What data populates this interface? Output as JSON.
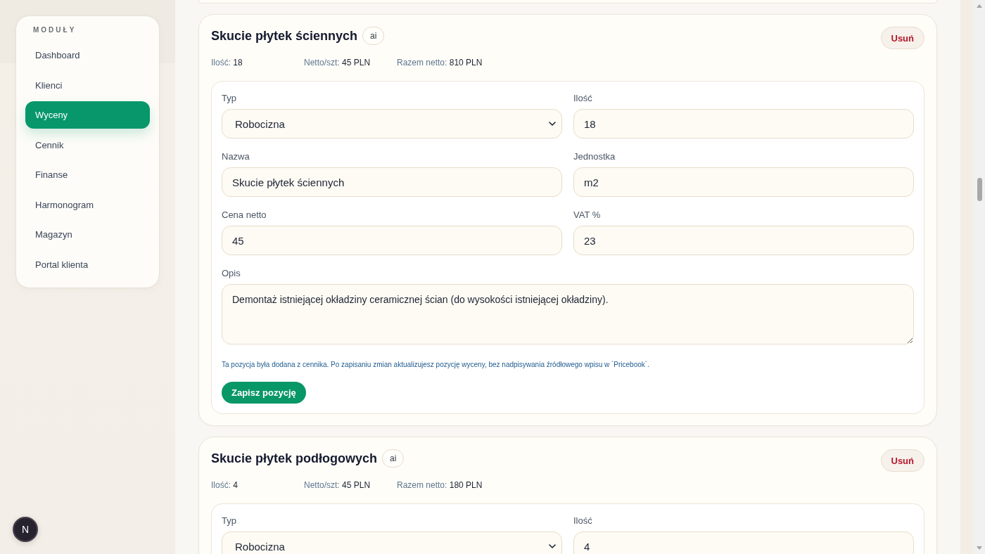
{
  "sidebar": {
    "heading": "MODUŁY",
    "items": [
      {
        "label": "Dashboard",
        "selected": false
      },
      {
        "label": "Klienci",
        "selected": false
      },
      {
        "label": "Wyceny",
        "selected": true
      },
      {
        "label": "Cennik",
        "selected": false
      },
      {
        "label": "Finanse",
        "selected": false
      },
      {
        "label": "Harmonogram",
        "selected": false
      },
      {
        "label": "Magazyn",
        "selected": false
      },
      {
        "label": "Portal klienta",
        "selected": false
      }
    ]
  },
  "dev_badge": {
    "label": "N"
  },
  "positions": [
    {
      "title": "Skucie płytek ściennych",
      "tag": "ai",
      "delete_button": "Usuń",
      "summary": [
        {
          "label": "Ilość:",
          "value": "18"
        },
        {
          "label": "Netto/szt:",
          "value": "45 PLN"
        },
        {
          "label": "Razem netto:",
          "value": "810 PLN"
        }
      ],
      "form": {
        "fields": [
          {
            "kind": "select",
            "label": "Typ",
            "value": "Robocizna"
          },
          {
            "kind": "input",
            "label": "Ilość",
            "value": "18"
          },
          {
            "kind": "input",
            "label": "Nazwa",
            "value": "Skucie płytek ściennych"
          },
          {
            "kind": "input",
            "label": "Jednostka",
            "value": "m2"
          },
          {
            "kind": "input",
            "label": "Cena netto",
            "value": "45"
          },
          {
            "kind": "input",
            "label": "VAT %",
            "value": "23"
          },
          {
            "kind": "textarea",
            "label": "Opis",
            "value": "Demontaż istniejącej okładziny ceramicznej ścian (do wysokości istniejącej okładziny)."
          }
        ],
        "note": "Ta pozycja była dodana z cennika. Po zapisaniu zmian aktualizujesz pozycję wyceny, bez nadpisywania źródłowego wpisu w `Pricebook`.",
        "save_button": "Zapisz pozycję"
      }
    },
    {
      "title": "Skucie płytek podłogowych",
      "tag": "ai",
      "delete_button": "Usuń",
      "summary": [
        {
          "label": "Ilość:",
          "value": "4"
        },
        {
          "label": "Netto/szt:",
          "value": "45 PLN"
        },
        {
          "label": "Razem netto:",
          "value": "180 PLN"
        }
      ],
      "form": {
        "fields": [
          {
            "kind": "select",
            "label": "Typ",
            "value": "Robocizna"
          },
          {
            "kind": "input",
            "label": "Ilość",
            "value": "4"
          }
        ]
      }
    }
  ]
}
